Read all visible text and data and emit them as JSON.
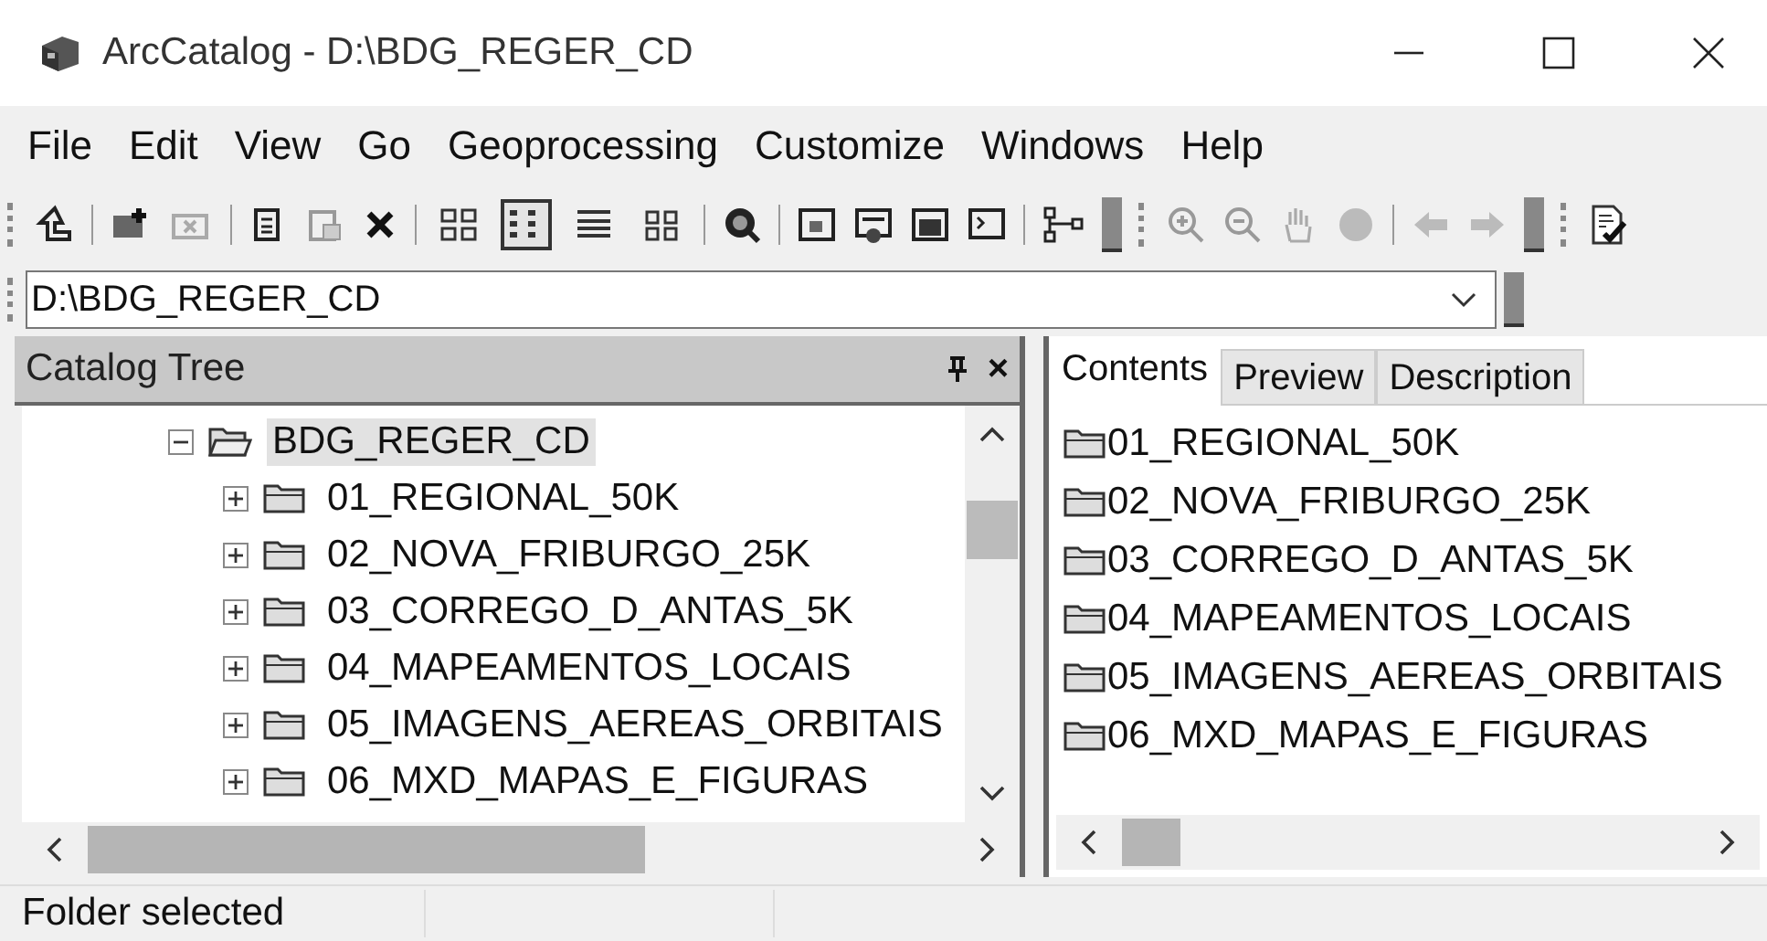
{
  "window": {
    "title": "ArcCatalog - D:\\BDG_REGER_CD"
  },
  "menu": [
    "File",
    "Edit",
    "View",
    "Go",
    "Geoprocessing",
    "Customize",
    "Windows",
    "Help"
  ],
  "view_buttons": [
    {
      "selected": false
    },
    {
      "selected": true
    },
    {
      "selected": false
    },
    {
      "selected": false
    }
  ],
  "address": {
    "value": "D:\\BDG_REGER_CD"
  },
  "catalog_tree": {
    "title": "Catalog Tree",
    "close": "×",
    "items": [
      {
        "label": "BDG_REGER_CD",
        "expanded": true,
        "selected": true,
        "children": [
          {
            "label": "01_REGIONAL_50K",
            "expanded": false,
            "selected": false
          },
          {
            "label": "02_NOVA_FRIBURGO_25K",
            "expanded": false,
            "selected": false
          },
          {
            "label": "03_CORREGO_D_ANTAS_5K",
            "expanded": false,
            "selected": false
          },
          {
            "label": "04_MAPEAMENTOS_LOCAIS",
            "expanded": false,
            "selected": false
          },
          {
            "label": "05_IMAGENS_AEREAS_ORBITAIS",
            "expanded": false,
            "selected": false
          },
          {
            "label": "06_MXD_MAPAS_E_FIGURAS",
            "expanded": false,
            "selected": false
          }
        ]
      }
    ]
  },
  "tabs": [
    {
      "label": "Contents",
      "selected": true
    },
    {
      "label": "Preview",
      "selected": false
    },
    {
      "label": "Description",
      "selected": false
    }
  ],
  "contents": [
    "01_REGIONAL_50K",
    "02_NOVA_FRIBURGO_25K",
    "03_CORREGO_D_ANTAS_5K",
    "04_MAPEAMENTOS_LOCAIS",
    "05_IMAGENS_AEREAS_ORBITAIS",
    "06_MXD_MAPAS_E_FIGURAS"
  ],
  "status_bar": {
    "text": "Folder selected"
  }
}
